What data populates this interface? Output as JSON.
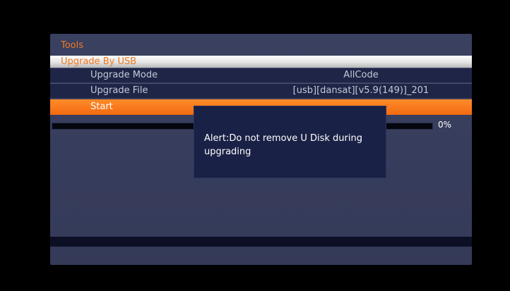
{
  "menu": {
    "title": "Tools",
    "section": "Upgrade By USB"
  },
  "rows": [
    {
      "label": "Upgrade Mode",
      "value": "AllCode"
    },
    {
      "label": "Upgrade File",
      "value": "[usb][dansat][v5.9(149)]_201"
    }
  ],
  "start": {
    "label": "Start"
  },
  "progress": {
    "percent_text": "0%",
    "value": 0
  },
  "alert": {
    "message": "Alert:Do not remove U Disk during\n upgrading"
  },
  "colors": {
    "accent_orange": "#f26a10",
    "panel_blue": "#3a4060",
    "row_navy": "#1e2546"
  }
}
